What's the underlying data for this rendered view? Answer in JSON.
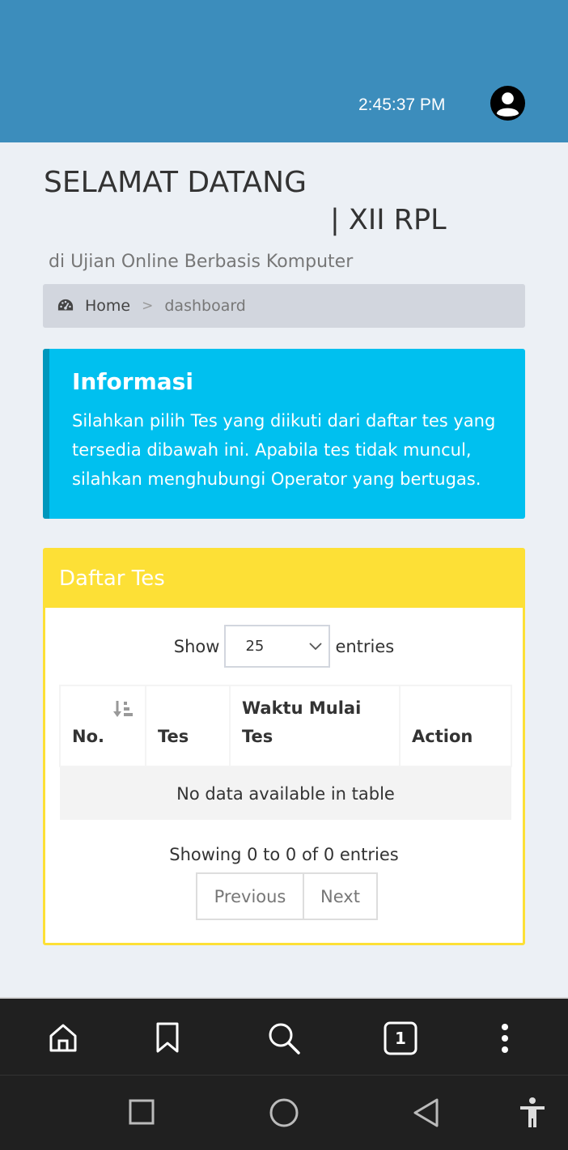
{
  "header": {
    "clock": "2:45:37 PM",
    "bg_color": "#3c8dbc",
    "avatar_icon": "user-circle-icon"
  },
  "welcome": {
    "title": "SELAMAT DATANG",
    "class_line": "| XII RPL",
    "subtitle": "di Ujian Online Berbasis Komputer"
  },
  "breadcrumb": {
    "icon": "dashboard-icon",
    "home": "Home",
    "separator": ">",
    "current": "dashboard"
  },
  "info_callout": {
    "title": "Informasi",
    "body": "Silahkan pilih Tes yang diikuti dari daftar tes yang tersedia dibawah ini. Apabila tes tidak muncul, silahkan menghubungi Operator yang bertugas.",
    "color": "#00c0ef"
  },
  "panel": {
    "title": "Daftar Tes",
    "accent": "#fde036",
    "show_label": "Show",
    "entries_label": "entries",
    "page_size": "25",
    "columns": [
      "No.",
      "Tes",
      "Waktu Mulai Tes",
      "Action"
    ],
    "empty_message": "No data available in table",
    "info": "Showing 0 to 0 of 0 entries",
    "prev_label": "Previous",
    "next_label": "Next"
  },
  "browser_nav": {
    "items": [
      "home-icon",
      "bookmark-icon",
      "search-icon",
      "tabs-icon",
      "more-icon"
    ],
    "tab_count": "1"
  },
  "system_nav": {
    "items": [
      "recent-apps-icon",
      "home-circle-icon",
      "back-icon",
      "accessibility-icon"
    ]
  }
}
